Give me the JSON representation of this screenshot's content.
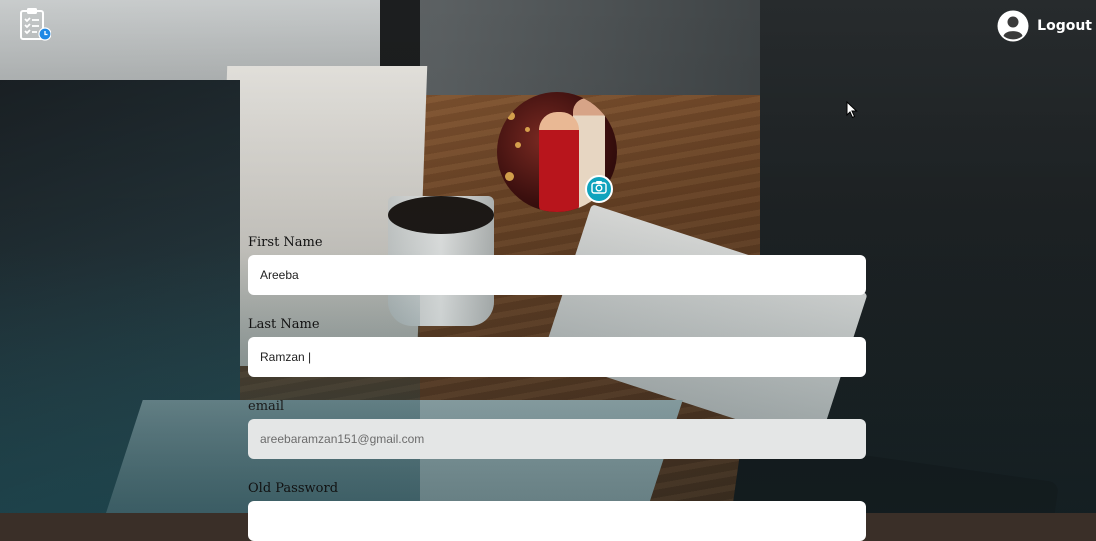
{
  "header": {
    "logo_icon": "clipboard-checklist-icon",
    "user_icon": "user-circle-icon",
    "logout_label": "Logout"
  },
  "profile": {
    "avatar_alt": "profile photo",
    "camera_icon": "camera-icon"
  },
  "form": {
    "first_name": {
      "label": "First Name",
      "value": "Areeba"
    },
    "last_name": {
      "label": "Last Name",
      "value": "Ramzan |"
    },
    "email": {
      "label": "email",
      "value": "areebaramzan151@gmail.com"
    },
    "old_password": {
      "label": "Old Password",
      "value": ""
    }
  },
  "colors": {
    "accent": "#0fa3bd",
    "input_bg": "#ffffff",
    "disabled_input_bg": "#e4e6e6"
  }
}
